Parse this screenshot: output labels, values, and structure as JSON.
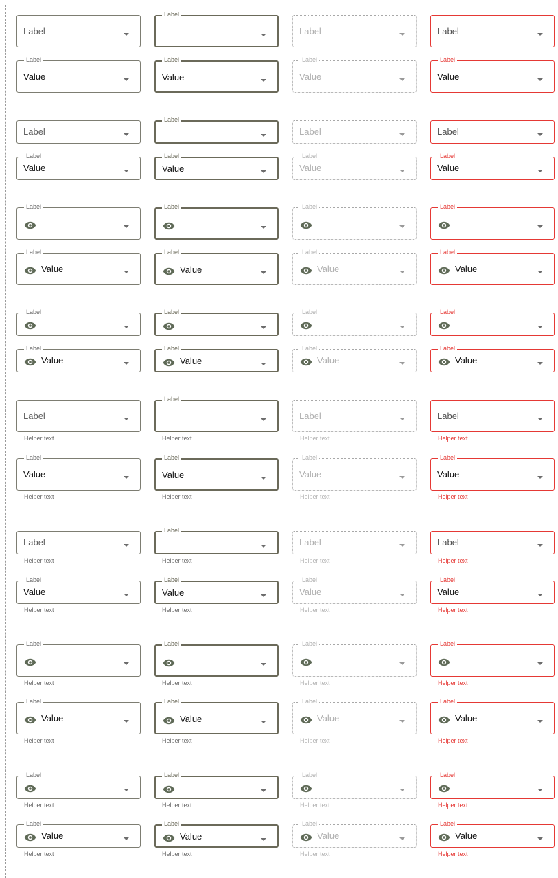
{
  "fields": {
    "label": "Label",
    "value": "Value",
    "helper": "Helper text",
    "states": [
      "enabled",
      "focused",
      "disabled",
      "error"
    ],
    "icons": {
      "leading": "eye-icon",
      "trailing": "dropdown-arrow-icon"
    }
  },
  "colors": {
    "outline": "#7d7d72",
    "focused": "#6b6a5a",
    "disabled": "#b0b0b0",
    "error": "#e53935",
    "icon": "#5f6a57"
  }
}
